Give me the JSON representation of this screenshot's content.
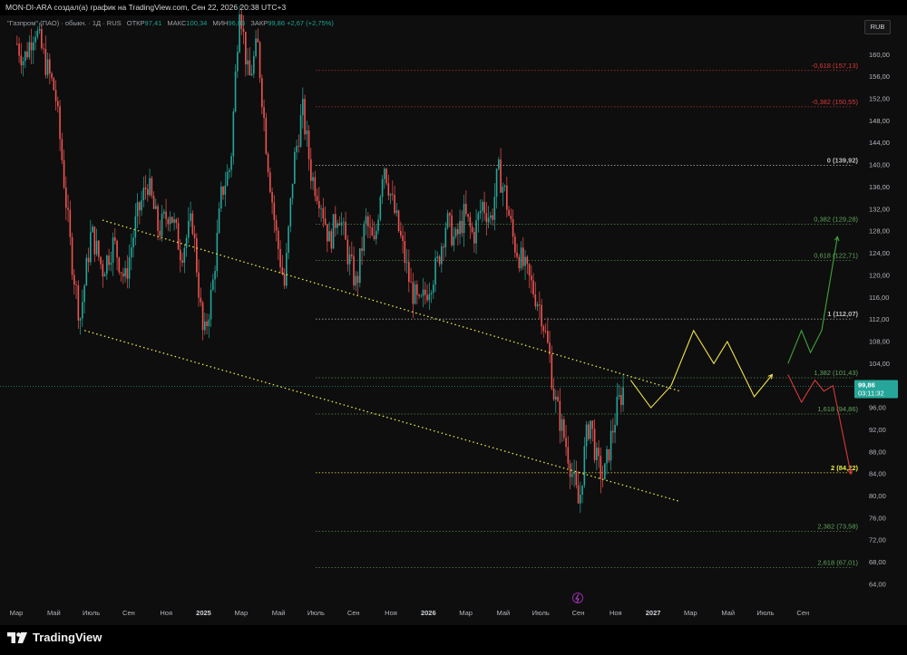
{
  "attribution": "MON-DI-ARA создал(а) график на TradingView.com, Сен 22, 2026 20:38 UTC+3",
  "legend": {
    "symbol": "\"Газпром\" (ПАО) · обыкн. · 1Д · RUS",
    "open_label": "ОТКР",
    "open": "97,41",
    "high_label": "МАКС",
    "high": "100,34",
    "low_label": "МИН",
    "low": "96,86",
    "close_label": "ЗАКР",
    "close": "99,86",
    "change": "+2,67 (+2,75%)"
  },
  "currency": "RUB",
  "price_badge": {
    "price": "99,86",
    "time": "03:11:32"
  },
  "brand": "TradingView",
  "colors": {
    "background": "#0e0e0e",
    "up": "#26a69a",
    "down": "#ef5350",
    "channel": "#e8e84a",
    "projection_yellow": "#f0e44a",
    "projection_green": "#3fa33a",
    "projection_red": "#d63a3a",
    "current_price": "#26a69a"
  },
  "chart_data": {
    "type": "candlestick",
    "x_ticks": [
      "Мар",
      "Май",
      "Июль",
      "Сен",
      "Ноя",
      "2025",
      "Мар",
      "Май",
      "Июль",
      "Сен",
      "Ноя",
      "2026",
      "Мар",
      "Май",
      "Июль",
      "Сен",
      "Ноя",
      "2027",
      "Мар",
      "Май",
      "Июль",
      "Сен"
    ],
    "y_ticks": [
      "160,00",
      "156,00",
      "152,00",
      "148,00",
      "144,00",
      "140,00",
      "136,00",
      "132,00",
      "128,00",
      "124,00",
      "120,00",
      "116,00",
      "112,00",
      "108,00",
      "104,00",
      "100,00",
      "96,00",
      "92,00",
      "88,00",
      "84,00",
      "80,00",
      "76,00",
      "72,00",
      "68,00",
      "64,00"
    ],
    "ylim": [
      62,
      168
    ],
    "current_price": 99.86,
    "fib_levels": [
      {
        "label": "-0,618 (157,13)",
        "price": 157.13,
        "color": "#d63a3a"
      },
      {
        "label": "-0,382 (150,55)",
        "price": 150.55,
        "color": "#d63a3a"
      },
      {
        "label": "0 (139,92)",
        "price": 139.92,
        "color": "#bdbdbd"
      },
      {
        "label": "0,382 (129,28)",
        "price": 129.28,
        "color": "#5fa35a"
      },
      {
        "label": "0,618 (122,71)",
        "price": 122.71,
        "color": "#5fa35a"
      },
      {
        "label": "1 (112,07)",
        "price": 112.07,
        "color": "#bdbdbd"
      },
      {
        "label": "1,382 (101,43)",
        "price": 101.43,
        "color": "#5fa35a"
      },
      {
        "label": "1,618 (94,86)",
        "price": 94.86,
        "color": "#5fa35a"
      },
      {
        "label": "2 (84,22)",
        "price": 84.22,
        "color": "#e8e84a"
      },
      {
        "label": "2,382 (73,58)",
        "price": 73.58,
        "color": "#5fa35a"
      },
      {
        "label": "2,618 (67,01)",
        "price": 67.01,
        "color": "#5fa35a"
      }
    ],
    "price_path": [
      [
        2024.17,
        162
      ],
      [
        2024.2,
        159
      ],
      [
        2024.25,
        165
      ],
      [
        2024.3,
        158
      ],
      [
        2024.34,
        153
      ],
      [
        2024.37,
        141
      ],
      [
        2024.41,
        124
      ],
      [
        2024.45,
        112
      ],
      [
        2024.5,
        128
      ],
      [
        2024.55,
        121
      ],
      [
        2024.6,
        126
      ],
      [
        2024.65,
        119
      ],
      [
        2024.7,
        130
      ],
      [
        2024.75,
        137
      ],
      [
        2024.8,
        128
      ],
      [
        2024.85,
        132
      ],
      [
        2024.9,
        124
      ],
      [
        2024.95,
        130
      ],
      [
        2025.0,
        108
      ],
      [
        2025.04,
        118
      ],
      [
        2025.08,
        135
      ],
      [
        2025.12,
        140
      ],
      [
        2025.16,
        170
      ],
      [
        2025.2,
        155
      ],
      [
        2025.24,
        162
      ],
      [
        2025.28,
        143
      ],
      [
        2025.32,
        128
      ],
      [
        2025.36,
        118
      ],
      [
        2025.4,
        140
      ],
      [
        2025.44,
        150
      ],
      [
        2025.48,
        138
      ],
      [
        2025.52,
        134
      ],
      [
        2025.56,
        126
      ],
      [
        2025.6,
        132
      ],
      [
        2025.64,
        124
      ],
      [
        2025.68,
        118
      ],
      [
        2025.72,
        130
      ],
      [
        2025.76,
        125
      ],
      [
        2025.8,
        141
      ],
      [
        2025.84,
        133
      ],
      [
        2025.88,
        126
      ],
      [
        2025.92,
        118
      ],
      [
        2025.96,
        114
      ],
      [
        2026.0,
        118
      ],
      [
        2026.04,
        122
      ],
      [
        2026.08,
        130
      ],
      [
        2026.12,
        126
      ],
      [
        2026.16,
        131
      ],
      [
        2026.2,
        127
      ],
      [
        2026.24,
        133
      ],
      [
        2026.28,
        130
      ],
      [
        2026.31,
        139
      ],
      [
        2026.34,
        135
      ],
      [
        2026.38,
        126
      ],
      [
        2026.42,
        122
      ],
      [
        2026.46,
        118
      ],
      [
        2026.5,
        114
      ],
      [
        2026.54,
        105
      ],
      [
        2026.56,
        98
      ],
      [
        2026.59,
        93
      ],
      [
        2026.62,
        88
      ],
      [
        2026.65,
        82
      ],
      [
        2026.67,
        78
      ],
      [
        2026.7,
        90
      ],
      [
        2026.72,
        94
      ],
      [
        2026.75,
        86
      ],
      [
        2026.78,
        83
      ],
      [
        2026.81,
        90
      ],
      [
        2026.84,
        96
      ],
      [
        2026.87,
        99.86
      ]
    ],
    "channel_lines": [
      {
        "from": [
          2024.55,
          130
        ],
        "to": [
          2027.12,
          99
        ]
      },
      {
        "from": [
          2024.47,
          110
        ],
        "to": [
          2027.12,
          79
        ]
      }
    ],
    "projections": [
      {
        "color": "#f0e44a",
        "points": [
          [
            2026.9,
            101
          ],
          [
            2026.99,
            96
          ],
          [
            2027.08,
            100
          ],
          [
            2027.18,
            110
          ],
          [
            2027.27,
            104
          ],
          [
            2027.33,
            108
          ],
          [
            2027.45,
            98
          ],
          [
            2027.53,
            102
          ]
        ]
      },
      {
        "color": "#3fa33a",
        "points": [
          [
            2027.6,
            104
          ],
          [
            2027.66,
            110
          ],
          [
            2027.7,
            106
          ],
          [
            2027.75,
            110
          ],
          [
            2027.82,
            127
          ]
        ]
      },
      {
        "color": "#d63a3a",
        "points": [
          [
            2027.6,
            102
          ],
          [
            2027.66,
            97
          ],
          [
            2027.72,
            101
          ],
          [
            2027.76,
            99
          ],
          [
            2027.8,
            100
          ],
          [
            2027.88,
            84
          ]
        ]
      }
    ]
  }
}
